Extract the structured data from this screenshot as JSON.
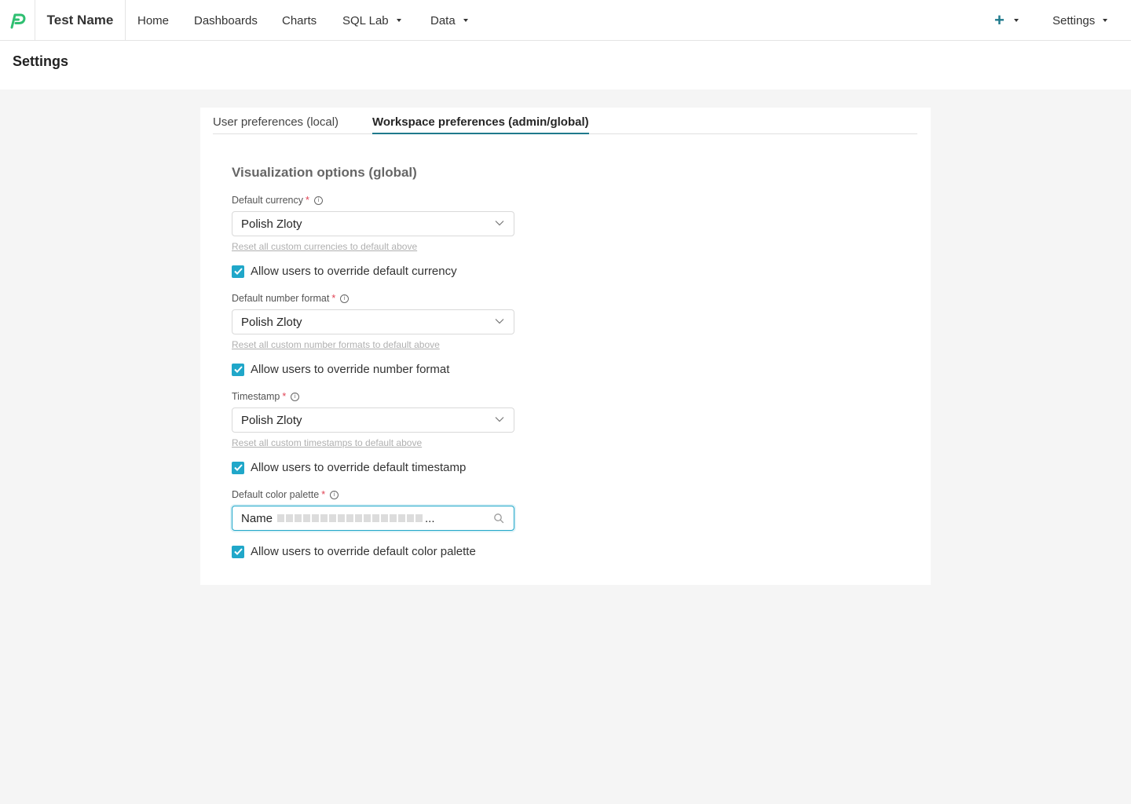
{
  "nav": {
    "brand": "Test Name",
    "items": [
      {
        "label": "Home"
      },
      {
        "label": "Dashboards"
      },
      {
        "label": "Charts"
      },
      {
        "label": "SQL Lab"
      },
      {
        "label": "Data"
      }
    ],
    "settings_label": "Settings"
  },
  "page": {
    "title": "Settings"
  },
  "tabs": [
    {
      "label": "User preferences (local)",
      "active": false
    },
    {
      "label": "Workspace preferences (admin/global)",
      "active": true
    }
  ],
  "form": {
    "section_title": "Visualization options (global)",
    "currency": {
      "label": "Default currency",
      "required_mark": "*",
      "value": "Polish Zloty",
      "reset_link": "Reset all custom currencies to default above",
      "override_label": "Allow users to override default currency",
      "override_checked": true
    },
    "number_format": {
      "label": "Default number format",
      "required_mark": "*",
      "value": "Polish Zloty",
      "reset_link": "Reset all custom number formats to default above",
      "override_label": "Allow users to override number format",
      "override_checked": true
    },
    "timestamp": {
      "label": "Timestamp",
      "required_mark": "*",
      "value": "Polish Zloty",
      "reset_link": "Reset all custom timestamps to default above",
      "override_label": "Allow users to override default timestamp",
      "override_checked": true
    },
    "color_palette": {
      "label": "Default color palette",
      "required_mark": "*",
      "value_prefix": "Name",
      "ellipsis": "...",
      "override_label": "Allow users to override default color palette",
      "override_checked": true
    }
  },
  "colors": {
    "accent": "#1f7a8c",
    "checkbox": "#20a7c9",
    "required": "#e04355",
    "logo": "#2fbf71"
  }
}
